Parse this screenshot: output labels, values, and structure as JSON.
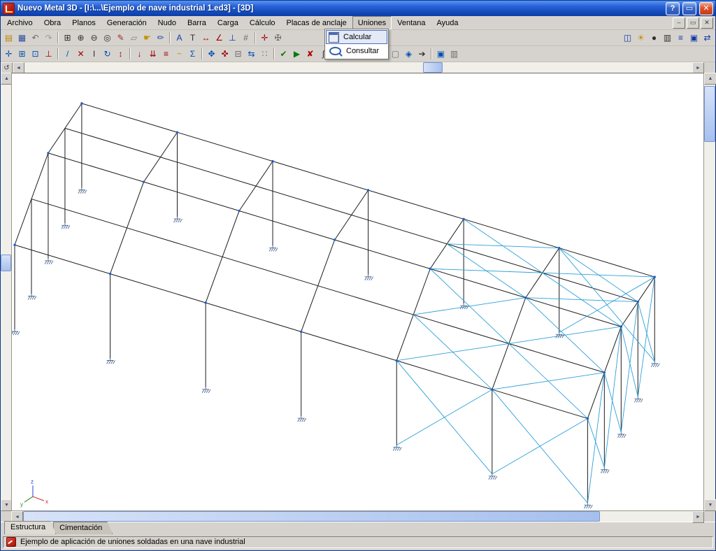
{
  "window": {
    "title": "Nuevo Metal 3D - [I:\\...\\Ejemplo de nave industrial 1.ed3] - [3D]",
    "controls": {
      "help": "?",
      "restore": "▭",
      "close": "✕"
    },
    "mdi": {
      "minimize": "–",
      "restore": "▭",
      "close": "✕"
    }
  },
  "menu": {
    "items": [
      {
        "name": "menu-item-archivo",
        "label": "Archivo"
      },
      {
        "name": "menu-item-obra",
        "label": "Obra"
      },
      {
        "name": "menu-item-planos",
        "label": "Planos"
      },
      {
        "name": "menu-item-generacion",
        "label": "Generación"
      },
      {
        "name": "menu-item-nudo",
        "label": "Nudo"
      },
      {
        "name": "menu-item-barra",
        "label": "Barra"
      },
      {
        "name": "menu-item-carga",
        "label": "Carga"
      },
      {
        "name": "menu-item-calculo",
        "label": "Cálculo"
      },
      {
        "name": "menu-item-placas-de-anclaje",
        "label": "Placas de anclaje"
      },
      {
        "name": "menu-item-uniones",
        "label": "Uniones",
        "open": true
      },
      {
        "name": "menu-item-ventana",
        "label": "Ventana"
      },
      {
        "name": "menu-item-ayuda",
        "label": "Ayuda"
      }
    ],
    "dropdown": {
      "items": [
        {
          "name": "menu-item-calcular",
          "label": "Calcular",
          "icon": "calculate-icon",
          "selected": true
        },
        {
          "name": "menu-item-consultar",
          "label": "Consultar",
          "icon": "consult-icon"
        }
      ]
    }
  },
  "toolbars": {
    "row1": [
      {
        "name": "open-file-icon",
        "g": "▤",
        "c": "#b8860b"
      },
      {
        "name": "save-icon",
        "g": "▦",
        "c": "#2f4f9e"
      },
      {
        "name": "undo-icon",
        "g": "↶",
        "c": "#6a6a6a"
      },
      {
        "name": "redo-icon",
        "g": "↷",
        "c": "#9a9a9a"
      },
      {
        "name": "zoom-window-icon",
        "g": "⊞",
        "c": "#303030",
        "sep": true
      },
      {
        "name": "zoom-in-icon",
        "g": "⊕",
        "c": "#303030"
      },
      {
        "name": "zoom-out-icon",
        "g": "⊖",
        "c": "#303030"
      },
      {
        "name": "zoom-extents-icon",
        "g": "◎",
        "c": "#303030"
      },
      {
        "name": "pencil-icon",
        "g": "✎",
        "c": "#a52a2a"
      },
      {
        "name": "eraser-icon",
        "g": "▱",
        "c": "#808080"
      },
      {
        "name": "pan-icon",
        "g": "☛",
        "c": "#c79100"
      },
      {
        "name": "edit-icon",
        "g": "✏",
        "c": "#1f4f9f"
      },
      {
        "name": "text-icon",
        "g": "A",
        "c": "#1038a8",
        "sep": true
      },
      {
        "name": "label-icon",
        "g": "T",
        "c": "#303030"
      },
      {
        "name": "dimension-icon",
        "g": "↔",
        "c": "#a00000"
      },
      {
        "name": "angle-icon",
        "g": "∠",
        "c": "#a00000"
      },
      {
        "name": "ortho-icon",
        "g": "⊥",
        "c": "#1038a8"
      },
      {
        "name": "grid-icon",
        "g": "#",
        "c": "#6a6a6a"
      },
      {
        "name": "crosshair-icon",
        "g": "✛",
        "c": "#a00000",
        "sep": true
      },
      {
        "name": "tools-icon",
        "g": "✠",
        "c": "#6a6a6a"
      }
    ],
    "row1_right": [
      {
        "name": "views-icon",
        "g": "◫",
        "c": "#1038a8"
      },
      {
        "name": "sun-icon",
        "g": "☀",
        "c": "#c79100"
      },
      {
        "name": "snapshot-icon",
        "g": "●",
        "c": "#303030"
      },
      {
        "name": "print-icon",
        "g": "▥",
        "c": "#303030"
      },
      {
        "name": "list-icon",
        "g": "≡",
        "c": "#1038a8"
      },
      {
        "name": "monitor-icon",
        "g": "▣",
        "c": "#1038a8"
      },
      {
        "name": "swap-icon",
        "g": "⇄",
        "c": "#1038a8"
      }
    ],
    "row2": [
      {
        "name": "node-new-icon",
        "g": "✛",
        "c": "#0050b3"
      },
      {
        "name": "node-grid-icon",
        "g": "⊞",
        "c": "#0050b3"
      },
      {
        "name": "node-bind-icon",
        "g": "⊡",
        "c": "#0050b3"
      },
      {
        "name": "support-icon",
        "g": "⊥",
        "c": "#a00000"
      },
      {
        "name": "bar-new-icon",
        "g": "/",
        "c": "#0050b3",
        "sep": true
      },
      {
        "name": "bar-cross-icon",
        "g": "✕",
        "c": "#a00000"
      },
      {
        "name": "profile-icon",
        "g": "I",
        "c": "#303030"
      },
      {
        "name": "rotate-icon",
        "g": "↻",
        "c": "#0050b3"
      },
      {
        "name": "axis-icon",
        "g": "↕",
        "c": "#a00000"
      },
      {
        "name": "load-point-icon",
        "g": "↓",
        "c": "#a00000",
        "sep": true
      },
      {
        "name": "load-linear-icon",
        "g": "⇊",
        "c": "#a00000"
      },
      {
        "name": "load-surface-icon",
        "g": "≡",
        "c": "#a00000"
      },
      {
        "name": "temperature-icon",
        "g": "~",
        "c": "#c79100"
      },
      {
        "name": "hypothesis-icon",
        "g": "Σ",
        "c": "#0050b3"
      },
      {
        "name": "move-icon",
        "g": "✥",
        "c": "#0050b3",
        "sep": true
      },
      {
        "name": "cross-icon",
        "g": "✜",
        "c": "#a00000"
      },
      {
        "name": "copy-icon",
        "g": "⊟",
        "c": "#6a6a6a"
      },
      {
        "name": "mirror-icon",
        "g": "⇆",
        "c": "#0050b3"
      },
      {
        "name": "array-icon",
        "g": "∷",
        "c": "#6a6a6a"
      },
      {
        "name": "check-icon",
        "g": "✔",
        "c": "#0a7a0a",
        "sep": true
      },
      {
        "name": "run-icon",
        "g": "▶",
        "c": "#0a7a0a"
      },
      {
        "name": "stop-icon",
        "g": "✘",
        "c": "#b00000"
      },
      {
        "name": "integral-icon",
        "g": "∫",
        "c": "#303030"
      },
      {
        "name": "deformed-icon",
        "g": "≈",
        "c": "#0050b3"
      },
      {
        "name": "union-weld-icon",
        "g": "✦",
        "c": "#0050b3",
        "sep": true
      },
      {
        "name": "union-check-icon",
        "g": "✓",
        "c": "#0a7a0a"
      },
      {
        "name": "forbidden-icon",
        "g": "⊗",
        "c": "#b00000"
      },
      {
        "name": "panel-icon",
        "g": "▢",
        "c": "#6a6a6a"
      },
      {
        "name": "diamond-icon",
        "g": "◈",
        "c": "#0050b3"
      },
      {
        "name": "arrow-icon",
        "g": "➔",
        "c": "#303030"
      },
      {
        "name": "screen-icon",
        "g": "▣",
        "c": "#0050b3",
        "sep": true
      },
      {
        "name": "sheet-icon",
        "g": "▥",
        "c": "#6a6a6a"
      }
    ]
  },
  "scroll": {
    "up": "▲",
    "down": "▼",
    "left": "◄",
    "right": "►",
    "rotate": "↺"
  },
  "tabs": [
    {
      "name": "tab-estructura",
      "label": "Estructura",
      "active": true
    },
    {
      "name": "tab-cimentacion",
      "label": "Cimentación",
      "active": false
    }
  ],
  "status": {
    "text": "Ejemplo de aplicación de uniones soldadas en una nave industrial"
  },
  "axes": {
    "x": "x",
    "y": "y",
    "z": "z"
  },
  "colors": {
    "frame": "#1c1c1c",
    "bracing": "#2da0d8",
    "node": "#1b5fcc",
    "support": "#3a5a86",
    "axis_x": "#cc2222",
    "axis_y": "#228822",
    "axis_z": "#2244cc"
  }
}
